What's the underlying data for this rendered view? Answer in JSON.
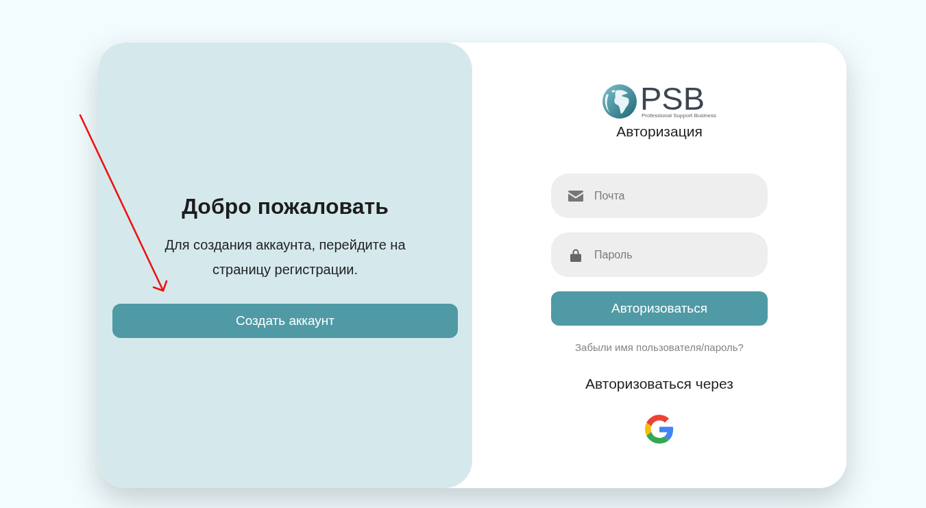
{
  "welcome_panel": {
    "title": "Добро пожаловать",
    "text": "Для создания аккаунта, перейдите на страницу регистрации.",
    "button": "Создать аккаунт"
  },
  "login_panel": {
    "logo": {
      "name": "PSB",
      "tagline": "Professional Support Business"
    },
    "title": "Авторизация",
    "fields": [
      {
        "kind": "email",
        "placeholder": "Почта"
      },
      {
        "kind": "password",
        "placeholder": "Пароль"
      }
    ],
    "submit": "Авторизоваться",
    "forgot_link": "Забыли имя пользователя/пароль?",
    "social_heading": "Авторизоваться через",
    "social_providers": [
      {
        "kind": "google"
      }
    ]
  },
  "annotations": [
    {
      "kind": "arrow"
    }
  ]
}
